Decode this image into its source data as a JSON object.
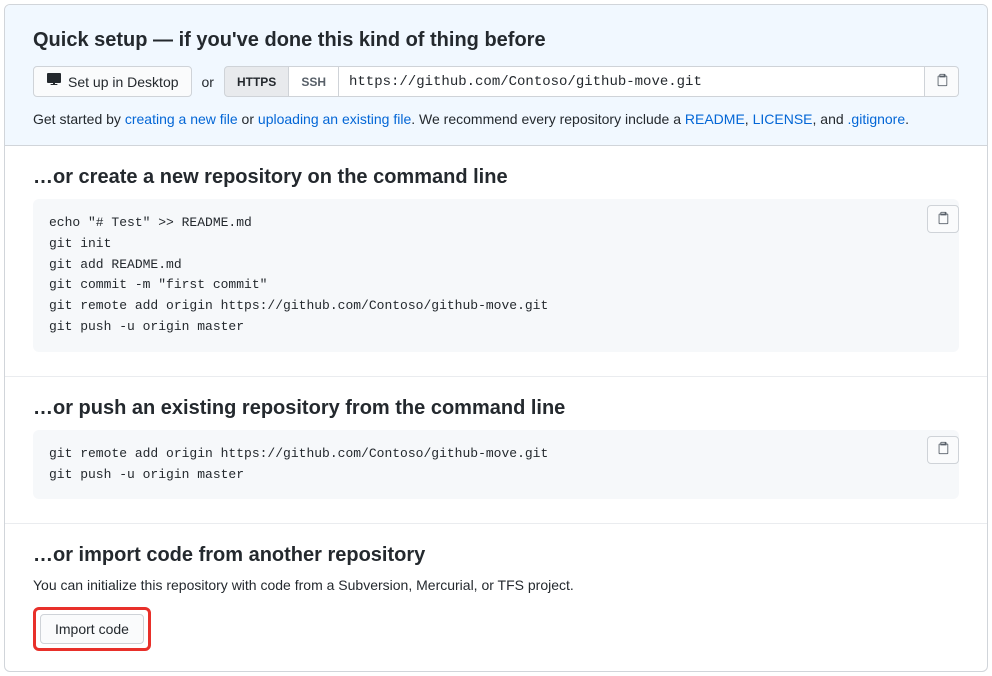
{
  "quickSetup": {
    "heading": "Quick setup — if you've done this kind of thing before",
    "desktopButton": "Set up in Desktop",
    "orText": "or",
    "httpsLabel": "HTTPS",
    "sshLabel": "SSH",
    "repoUrl": "https://github.com/Contoso/github-move.git",
    "helpPrefix": "Get started by ",
    "linkNewFile": "creating a new file",
    "helpOr": " or ",
    "linkUpload": "uploading an existing file",
    "helpMiddle": ". We recommend every repository include a ",
    "linkReadme": "README",
    "helpComma": ", ",
    "linkLicense": "LICENSE",
    "helpAnd": ", and ",
    "linkGitignore": ".gitignore",
    "helpEnd": "."
  },
  "createSection": {
    "heading": "…or create a new repository on the command line",
    "code": "echo \"# Test\" >> README.md\ngit init\ngit add README.md\ngit commit -m \"first commit\"\ngit remote add origin https://github.com/Contoso/github-move.git\ngit push -u origin master"
  },
  "pushSection": {
    "heading": "…or push an existing repository from the command line",
    "code": "git remote add origin https://github.com/Contoso/github-move.git\ngit push -u origin master"
  },
  "importSection": {
    "heading": "…or import code from another repository",
    "desc": "You can initialize this repository with code from a Subversion, Mercurial, or TFS project.",
    "button": "Import code"
  }
}
